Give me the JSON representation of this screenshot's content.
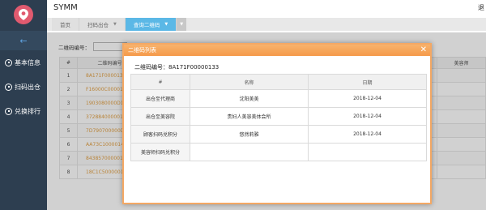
{
  "app": {
    "title": "SYMM",
    "top_right": "退"
  },
  "sidebar": {
    "logo_icon": "map-pin-icon",
    "collapse_icon": "arrow-left-icon",
    "items": [
      {
        "label": "基本信息",
        "icon": "user-icon"
      },
      {
        "label": "扫码出仓",
        "icon": "scan-icon"
      },
      {
        "label": "兑换排行",
        "icon": "rank-icon"
      }
    ]
  },
  "tabs": [
    {
      "label": "首页"
    },
    {
      "label": "扫码出仓"
    },
    {
      "label": "查询二维码"
    }
  ],
  "page": {
    "search_label": "二维码编号：",
    "search_value": "",
    "table": {
      "headers": [
        "#",
        "二维码编号",
        "",
        "",
        "",
        "",
        "",
        "美容师"
      ],
      "rows": [
        {
          "n": "1",
          "code": "8A171F000013"
        },
        {
          "n": "2",
          "code": "F16000C00001"
        },
        {
          "n": "3",
          "code": "1903080000D1"
        },
        {
          "n": "4",
          "code": "3728840000014"
        },
        {
          "n": "5",
          "code": "7D790700000D1"
        },
        {
          "n": "6",
          "code": "AA73C1000014"
        },
        {
          "n": "7",
          "code": "8438570000014"
        },
        {
          "n": "8",
          "code": "18C1C50000014"
        }
      ]
    }
  },
  "modal": {
    "title": "二维码列表",
    "subtitle": "二维码编号：8A171F00000133",
    "headers": [
      "#",
      "名称",
      "日期"
    ],
    "rows": [
      {
        "label": "出仓至代理商",
        "name": "沈阳美美",
        "date": "2018-12-04"
      },
      {
        "label": "出仓至美容院",
        "name": "贵妇人美容美体会所",
        "date": "2018-12-04"
      },
      {
        "label": "顾客扫码兑积分",
        "name": "悠然莉雅",
        "date": "2018-12-04"
      },
      {
        "label": "美容师扫码兑积分",
        "name": "",
        "date": ""
      }
    ]
  },
  "colors": {
    "sidebar": "#2d3e50",
    "accent_tab": "#5bb8e6",
    "modal_header": "#f59a4a",
    "link_code": "#e2a247"
  }
}
